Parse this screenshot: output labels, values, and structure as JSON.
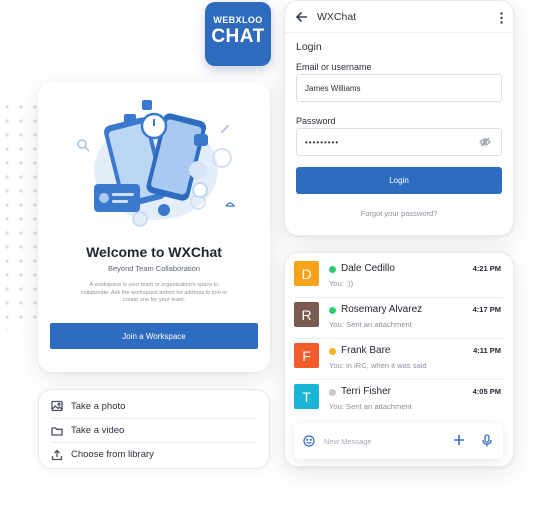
{
  "brand": {
    "logo_line1": "WEBXLOO",
    "logo_line2": "CHAT"
  },
  "welcome": {
    "title": "Welcome to WXChat",
    "subtitle": "Beyond Team Collaboration",
    "description": "A workspace is your team or organization's space to collaborate. Ask the workspace admin for address to join or create one for your team.",
    "join_button": "Join a Workspace"
  },
  "media_options": [
    {
      "label": "Take a photo",
      "icon": "image-icon"
    },
    {
      "label": "Take a video",
      "icon": "folder-icon"
    },
    {
      "label": "Choose from library",
      "icon": "upload-icon"
    }
  ],
  "login": {
    "app_title": "WXChat",
    "heading": "Login",
    "username_label": "Email or username",
    "username_value": "James Williams",
    "password_label": "Password",
    "password_value": "•••••••••",
    "login_button": "Login",
    "forgot_link": "Forgot your password?"
  },
  "chats": [
    {
      "initial": "D",
      "name": "Dale Cedillo",
      "time": "4:21 PM",
      "message": "You: :))",
      "avatar_color": "#f7a21b",
      "status_color": "#2ecc71"
    },
    {
      "initial": "R",
      "name": "Rosemary Alvarez",
      "time": "4:17 PM",
      "message": "You: Sent an attachment",
      "avatar_color": "#7b5a4f",
      "status_color": "#2ecc71"
    },
    {
      "initial": "F",
      "name": "Frank Bare",
      "time": "4:11 PM",
      "message": "You: in iRC, when it was said",
      "avatar_color": "#f25b2a",
      "status_color": "#f5b31b"
    },
    {
      "initial": "T",
      "name": "Terri Fisher",
      "time": "4:05 PM",
      "message": "You: Sent an attachment",
      "avatar_color": "#19b4d6",
      "status_color": "#c4c8cf"
    }
  ],
  "composer": {
    "placeholder": "New Message"
  },
  "colors": {
    "accent": "#2e6cc1",
    "logo_bg": "#2f6bbd"
  }
}
